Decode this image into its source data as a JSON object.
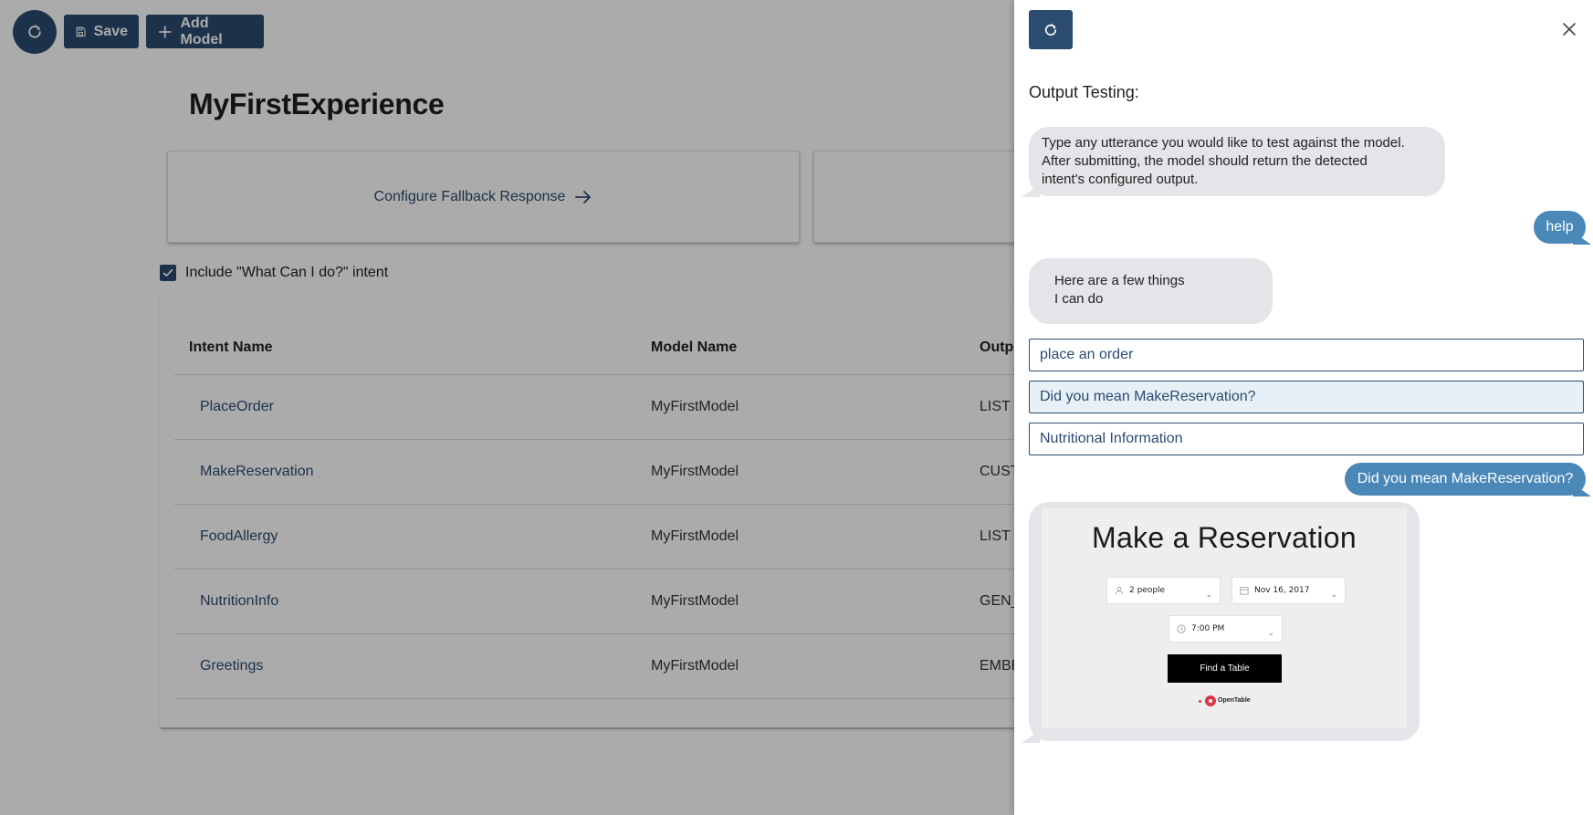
{
  "toolbar": {
    "save_label": "Save",
    "add_model_label": "Add Model"
  },
  "page": {
    "title": "MyFirstExperience"
  },
  "cards": {
    "fallback_label": "Configure Fallback Response"
  },
  "include_intent": {
    "label": "Include \"What Can I do?\" intent",
    "checked": true
  },
  "table": {
    "headers": [
      "Intent Name",
      "Model Name",
      "Outp"
    ],
    "rows": [
      {
        "intent": "PlaceOrder",
        "model": "MyFirstModel",
        "output": "LIST"
      },
      {
        "intent": "MakeReservation",
        "model": "MyFirstModel",
        "output": "CUSTO"
      },
      {
        "intent": "FoodAllergy",
        "model": "MyFirstModel",
        "output": "LIST"
      },
      {
        "intent": "NutritionInfo",
        "model": "MyFirstModel",
        "output": "GEN_"
      },
      {
        "intent": "Greetings",
        "model": "MyFirstModel",
        "output": "EMBE"
      }
    ]
  },
  "drawer": {
    "heading": "Output Testing:",
    "intro_lines": [
      "Type any utterance you would like to test against the model.",
      "After submitting, the model should return the detected",
      "intent's configured output."
    ],
    "user_msg_1": "help",
    "bot_reply_lines": [
      "Here are a few things",
      "I can do"
    ],
    "options": [
      "place an order",
      "Did you mean MakeReservation?",
      "Nutritional Information"
    ],
    "user_msg_2": "Did you mean MakeReservation?",
    "embed": {
      "title": "Make a Reservation",
      "party_size": "2 people",
      "date": "Nov 16, 2017",
      "time": "7:00 PM",
      "button": "Find a Table",
      "brand": "OpenTable"
    }
  },
  "colors": {
    "primary": "#2b4b6f",
    "user_bubble": "#4a88b8",
    "bot_bubble": "#e4e4e9",
    "opentable_red": "#da3743"
  }
}
